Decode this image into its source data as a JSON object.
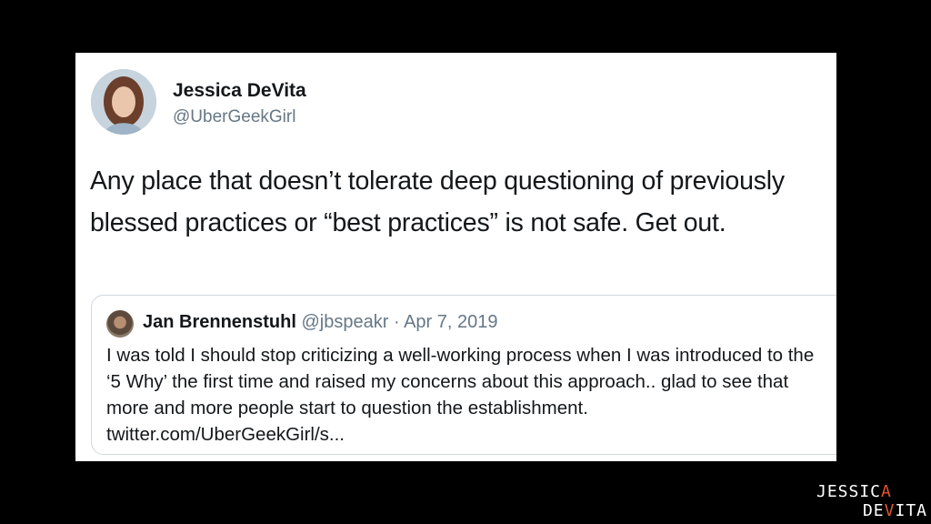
{
  "tweet": {
    "author_name": "Jessica DeVita",
    "author_handle": "@UberGeekGirl",
    "text": "Any place that doesn’t tolerate deep questioning of previously blessed practices or “best practices” is not safe. Get out."
  },
  "quoted_tweet": {
    "author_name": "Jan Brennenstuhl",
    "author_handle": "@jbspeakr",
    "separator": "·",
    "date": "Apr 7, 2019",
    "text": "I was told I should stop criticizing a well-working process when I was introduced to the ‘5 Why’ the first time and raised my concerns about this approach.. glad to see that more and more people start to question the establishment. twitter.com/UberGeekGirl/s..."
  },
  "branding": {
    "line1_main": "JESSIC",
    "line1_accent": "A",
    "line2_start": "DE",
    "line2_accent": "V",
    "line2_end": "ITA",
    "accent_color": "#e0552b"
  }
}
